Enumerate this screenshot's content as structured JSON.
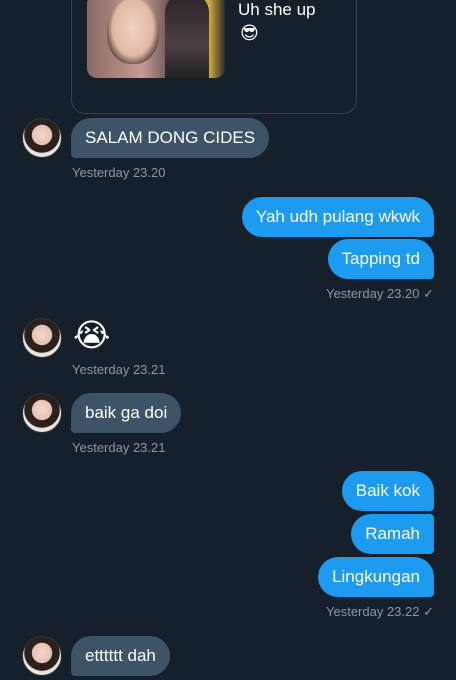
{
  "shared": {
    "caption": "Uh she up",
    "emoji": "😎"
  },
  "messages": {
    "m1": {
      "text": "SALAM DONG CIDES",
      "time": "Yesterday 23.20"
    },
    "m2a": {
      "text": "Yah udh pulang wkwk"
    },
    "m2b": {
      "text": "Tapping td",
      "time": "Yesterday 23.20 ✓"
    },
    "m3": {
      "text": "😭",
      "time": "Yesterday 23.21"
    },
    "m4": {
      "text": "baik ga doi",
      "time": "Yesterday 23.21"
    },
    "m5a": {
      "text": "Baik kok"
    },
    "m5b": {
      "text": "Ramah"
    },
    "m5c": {
      "text": "Lingkungan",
      "time": "Yesterday 23.22 ✓"
    },
    "m6": {
      "text": "etttttt dah"
    }
  },
  "colors": {
    "background": "#15202b",
    "incoming_bubble": "#3d5466",
    "outgoing_bubble": "#1d9bf0",
    "meta_text": "#8b98a5"
  }
}
